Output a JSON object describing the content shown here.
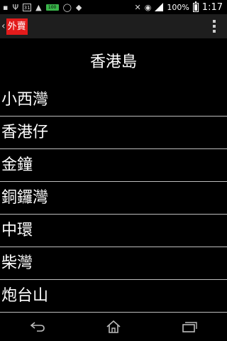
{
  "status_bar": {
    "calendar_date": "31",
    "storage_badge": "100",
    "battery_percent": "100%",
    "time": "1:17",
    "icons": [
      "notification-icon",
      "usb-icon",
      "calendar-icon",
      "image-icon",
      "storage-icon",
      "whatsapp-icon",
      "android-icon",
      "bluetooth-icon",
      "alarm-icon",
      "signal-icon",
      "battery-icon"
    ]
  },
  "action_bar": {
    "back_label": "外賣",
    "accent_color": "#e31b1b"
  },
  "page": {
    "title": "香港島"
  },
  "areas": [
    {
      "label": "小西灣"
    },
    {
      "label": "香港仔"
    },
    {
      "label": "金鐘"
    },
    {
      "label": "銅鑼灣"
    },
    {
      "label": "中環"
    },
    {
      "label": "柴灣"
    },
    {
      "label": "炮台山"
    }
  ],
  "nav_bar": {
    "buttons": [
      "back-icon",
      "home-icon",
      "recent-apps-icon"
    ]
  }
}
